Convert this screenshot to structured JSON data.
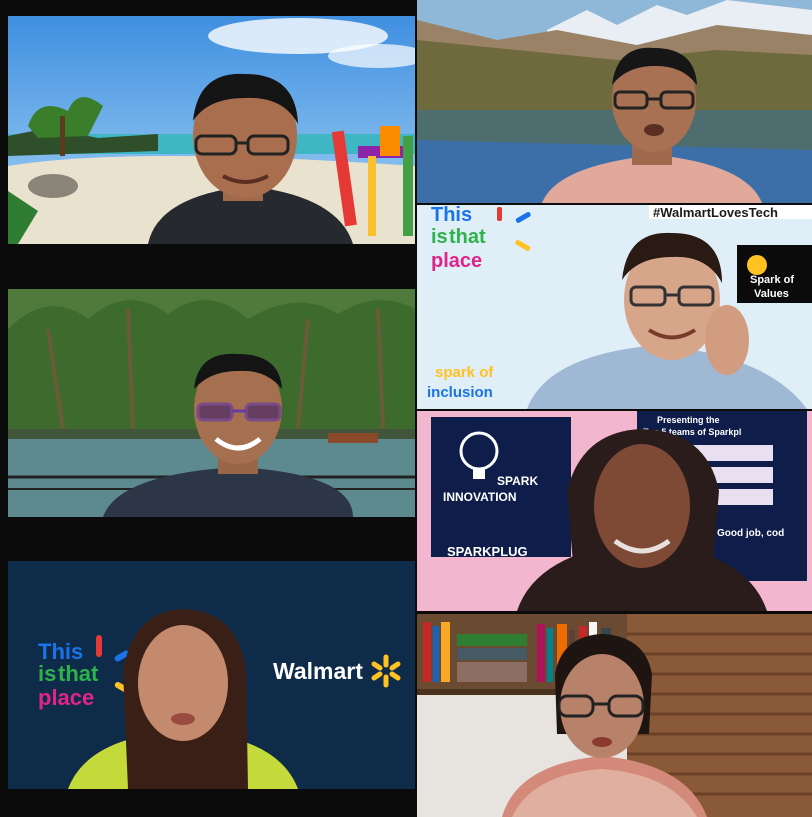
{
  "tiles": [
    {
      "id": "t1",
      "background": "beach"
    },
    {
      "id": "t2",
      "background": "mountain-lake"
    },
    {
      "id": "t3",
      "background": "branding",
      "brand": {
        "line1": "This",
        "line2a": "is",
        "line2b": "that",
        "line3": "place",
        "hashtag": "#WalmartLovesTech",
        "spark_values_1": "Spark of",
        "spark_values_2": "Values",
        "spark_inclusion_1": "spark of",
        "spark_inclusion_2": "inclusion"
      }
    },
    {
      "id": "t4",
      "background": "palm-lagoon"
    },
    {
      "id": "t5",
      "background": "innovation-poster",
      "poster": {
        "spark": "SPARK",
        "innovation": "INNOVATION",
        "sparkplug": "SPARKPLUG",
        "presenting": "Presenting the",
        "top": "Top 5 teams of Sparkpl",
        "good_job": "Good job, cod"
      }
    },
    {
      "id": "t6",
      "background": "walmart-branding",
      "brand": {
        "line1": "This",
        "line2a": "is",
        "line2b": "that",
        "line3": "place",
        "walmart": "Walmart"
      }
    },
    {
      "id": "t7",
      "background": "bookshelf"
    }
  ],
  "colors": {
    "gap": "#0b0b0b",
    "walmart_yellow": "#ffc220",
    "brand_blue": "#1a73e8",
    "brand_green": "#2db34a",
    "brand_pink": "#e0258a",
    "brand_red": "#e53935"
  }
}
